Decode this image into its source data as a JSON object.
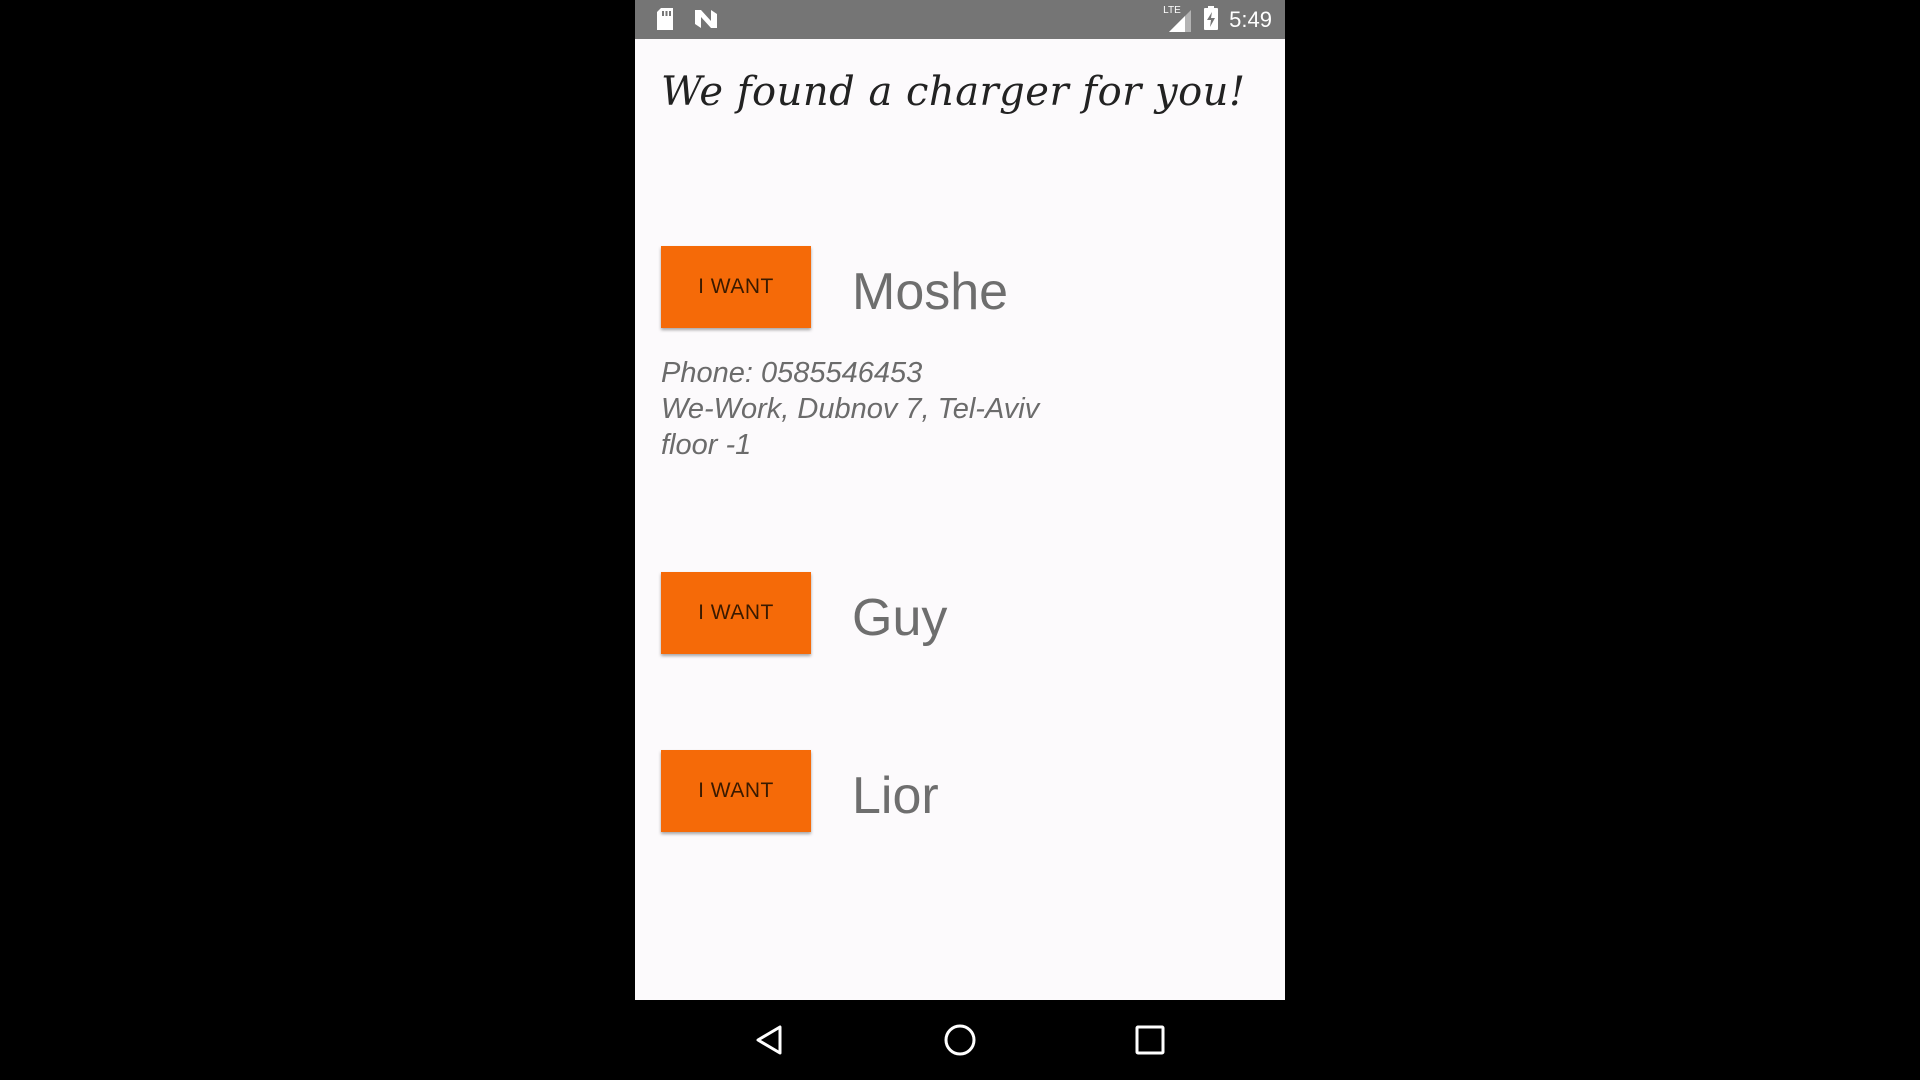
{
  "status_bar": {
    "time": "5:49",
    "network_label": "LTE",
    "icons": [
      "sd-card-icon",
      "n-notification-icon",
      "signal-icon",
      "battery-charging-icon"
    ]
  },
  "screen": {
    "headline": "We found a charger for you!",
    "accent_color": "#f56a08",
    "rows": [
      {
        "button_label": "I WANT",
        "name": "Moshe",
        "details": [
          "Phone: 0585546453",
          "We-Work, Dubnov 7, Tel-Aviv",
          "floor -1"
        ]
      },
      {
        "button_label": "I WANT",
        "name": "Guy"
      },
      {
        "button_label": "I WANT",
        "name": "Lior"
      }
    ]
  },
  "nav_bar": {
    "icons": [
      "back-icon",
      "home-icon",
      "recents-icon"
    ]
  }
}
